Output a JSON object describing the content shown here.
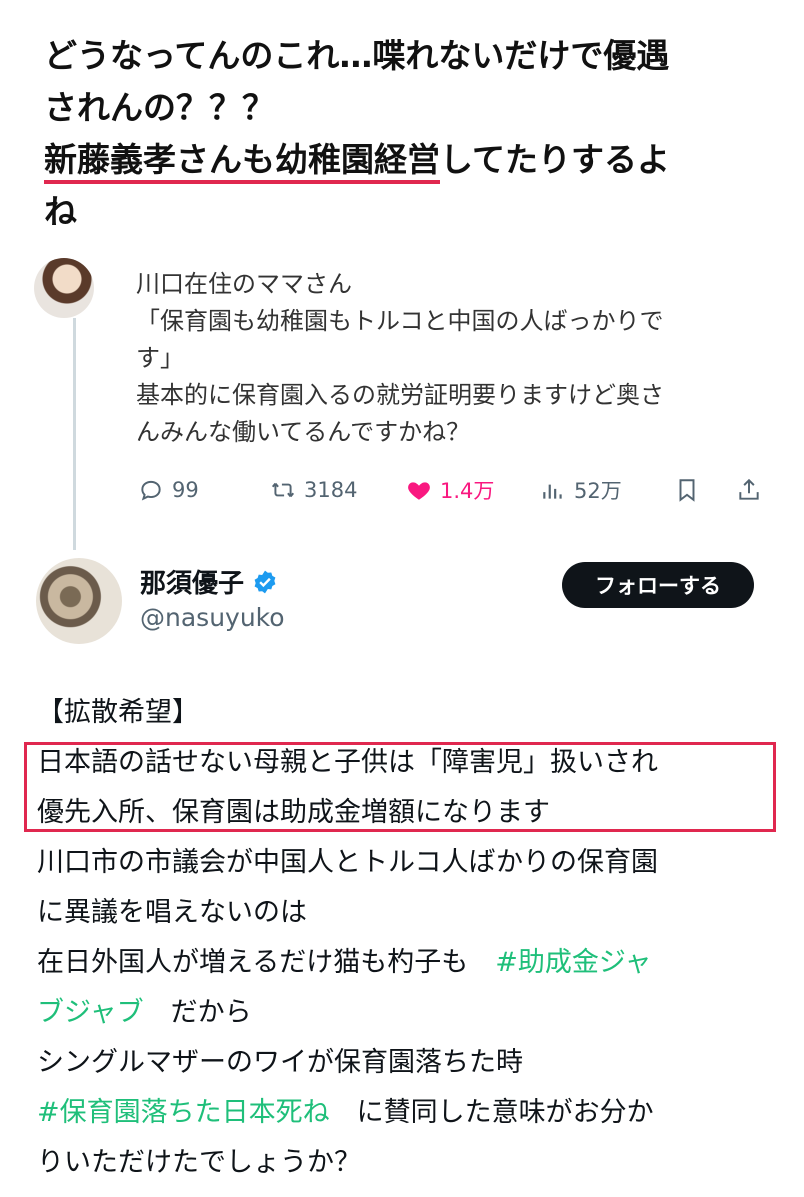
{
  "headline": {
    "line1": "どうなってんのこれ…喋れないだけで優遇",
    "line2": "されんの？？？",
    "line3_highlight": "新藤義孝さんも幼稚園経営",
    "line3_rest": "してたりするよ",
    "line4": "ね"
  },
  "quoted_post": {
    "author": "川口在住のママさん",
    "text_line1": "「保育園も幼稚園もトルコと中国の人ばっかりで",
    "text_line2": "す」",
    "text_line3": "基本的に保育園入るの就労証明要りますけど奥さ",
    "text_line4": "んみんな働いてるんですかね？",
    "actions": {
      "replies": "99",
      "reposts": "3184",
      "likes": "1.4万",
      "views": "52万"
    }
  },
  "tweet": {
    "author_name": "那須優子",
    "handle": "@nasuyuko",
    "follow_label": "フォローする",
    "lines": [
      {
        "text": "【拡散希望】"
      },
      {
        "text": "日本語の話せない母親と子供は「障害児」扱いされ"
      },
      {
        "text": "優先入所、保育園は助成金増額になります"
      },
      {
        "text": "川口市の市議会が中国人とトルコ人ばかりの保育園"
      },
      {
        "text": "に異議を唱えないのは"
      },
      {
        "text": "在日外国人が増えるだけ猫も杓子も　",
        "tag": "#助成金ジャ"
      },
      {
        "tag": "ブジャブ",
        "text_after": "　だから"
      },
      {
        "text": "シングルマザーのワイが保育園落ちた時"
      },
      {
        "tag": "#保育園落ちた日本死ね",
        "text_after": "　に賛同した意味がお分か"
      },
      {
        "text": "りいただけたでしょうか？"
      }
    ]
  },
  "colors": {
    "highlight": "#e0284f",
    "hashtag": "#1fbf7a",
    "like": "#f91880",
    "verified": "#1d9bf0"
  }
}
